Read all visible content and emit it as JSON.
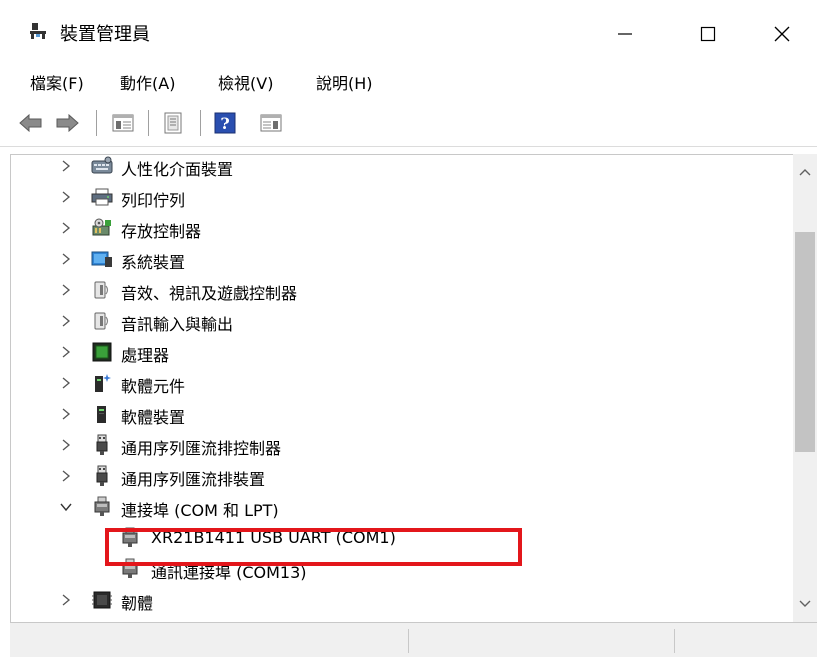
{
  "window": {
    "title": "裝置管理員"
  },
  "menu": [
    {
      "label": "檔案(F)"
    },
    {
      "label": "動作(A)"
    },
    {
      "label": "檢視(V)"
    },
    {
      "label": "說明(H)"
    }
  ],
  "toolbar": {
    "back_icon": "back-arrow-icon",
    "forward_icon": "forward-arrow-icon",
    "help_glyph": "?"
  },
  "tree": {
    "rows": [
      {
        "label": "人性化介面裝置",
        "icon": "hid-icon",
        "expanded": false
      },
      {
        "label": "列印佇列",
        "icon": "printer-icon",
        "expanded": false
      },
      {
        "label": "存放控制器",
        "icon": "storage-controller-icon",
        "expanded": false
      },
      {
        "label": "系統裝置",
        "icon": "system-device-icon",
        "expanded": false
      },
      {
        "label": "音效、視訊及遊戲控制器",
        "icon": "speaker-icon",
        "expanded": false
      },
      {
        "label": "音訊輸入與輸出",
        "icon": "speaker-icon",
        "expanded": false
      },
      {
        "label": "處理器",
        "icon": "processor-icon",
        "expanded": false
      },
      {
        "label": "軟體元件",
        "icon": "software-component-icon",
        "expanded": false
      },
      {
        "label": "軟體裝置",
        "icon": "software-device-icon",
        "expanded": false
      },
      {
        "label": "通用序列匯流排控制器",
        "icon": "usb-icon",
        "expanded": false
      },
      {
        "label": "通用序列匯流排裝置",
        "icon": "usb-icon",
        "expanded": false
      },
      {
        "label": "連接埠 (COM 和 LPT)",
        "icon": "port-icon",
        "expanded": true
      },
      {
        "label": "XR21B1411 USB UART (COM1)",
        "icon": "port-icon",
        "child": true
      },
      {
        "label": "通訊連接埠 (COM13)",
        "icon": "port-icon",
        "child": true
      },
      {
        "label": "韌體",
        "icon": "firmware-icon",
        "expanded": false
      }
    ]
  },
  "colors": {
    "highlight": "#e3161b",
    "scroll_thumb": "#c3c3c3"
  }
}
